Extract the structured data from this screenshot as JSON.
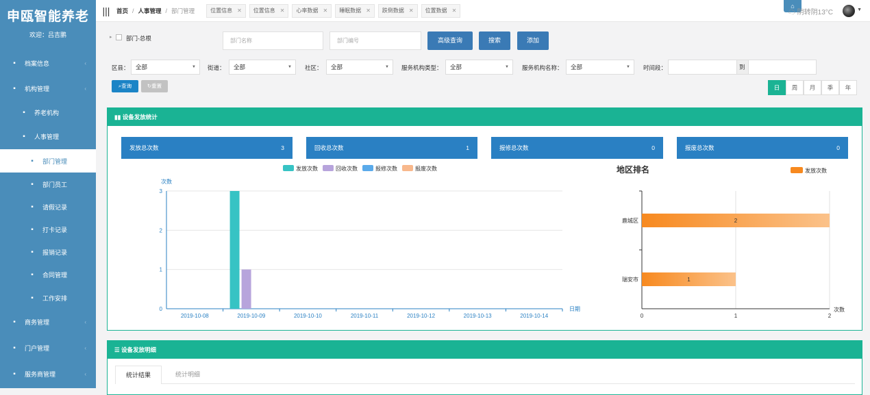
{
  "app": {
    "logo": "申瓯智能养老",
    "welcome": "欢迎：吕吉鹏"
  },
  "sidebar": {
    "items": [
      {
        "label": "档案信息",
        "icon": "archive-icon"
      },
      {
        "label": "机构管理",
        "icon": "users-icon"
      },
      {
        "label": "养老机构",
        "icon": "elder-icon"
      },
      {
        "label": "人事管理",
        "icon": "users-icon"
      },
      {
        "label": "部门管理",
        "icon": "sitemap-icon"
      },
      {
        "label": "部门员工",
        "icon": "id-card-icon"
      },
      {
        "label": "请假记录",
        "icon": "user-clock-icon"
      },
      {
        "label": "打卡记录",
        "icon": "map-pin-icon"
      },
      {
        "label": "报销记录",
        "icon": "receipt-icon"
      },
      {
        "label": "合同管理",
        "icon": "contract-icon"
      },
      {
        "label": "工作安排",
        "icon": "worker-icon"
      },
      {
        "label": "商务管理",
        "icon": "briefcase-icon"
      },
      {
        "label": "门户管理",
        "icon": "home-icon"
      },
      {
        "label": "服务商管理",
        "icon": "user-icon"
      }
    ]
  },
  "topbar": {
    "breadcrumb": [
      "首页",
      "人事管理",
      "部门管理"
    ],
    "tabs": [
      "位置信息",
      "位置信息",
      "心率数据",
      "睡眠数据",
      "跌倒数据",
      "位置数据"
    ],
    "weather": "阴转阴13°C",
    "home_glyph": "⌂"
  },
  "filters": {
    "tree_label": "部门-总根",
    "dept_name_placeholder": "部门名称",
    "dept_code_placeholder": "部门编号",
    "advanced": "高级查询",
    "search": "搜索",
    "add": "添加",
    "district_label": "区县：",
    "district_value": "全部",
    "street_label": "街道：",
    "street_value": "全部",
    "community_label": "社区：",
    "community_value": "全部",
    "org_type_label": "服务机构类型：",
    "org_type_value": "全部",
    "org_name_label": "服务机构名称：",
    "org_name_value": "全部",
    "time_label": "时间段：",
    "time_to": "到",
    "query": "查询",
    "reset": "重置",
    "periods": [
      "日",
      "周",
      "月",
      "季",
      "年"
    ],
    "active_period": "日"
  },
  "stats_panel": {
    "title": "设备发放统计",
    "cards": [
      {
        "label": "发放总次数",
        "value": "3"
      },
      {
        "label": "回收总次数",
        "value": "1"
      },
      {
        "label": "报修总次数",
        "value": "0"
      },
      {
        "label": "报废总次数",
        "value": "0"
      }
    ]
  },
  "chart_data": [
    {
      "type": "bar",
      "xlabel": "日期",
      "ylabel": "次数",
      "ylim": [
        0,
        3
      ],
      "yticks": [
        0,
        1,
        2,
        3
      ],
      "categories": [
        "2019-10-08",
        "2019-10-09",
        "2019-10-10",
        "2019-10-11",
        "2019-10-12",
        "2019-10-13",
        "2019-10-14"
      ],
      "series": [
        {
          "name": "发放次数",
          "color": "#37c3c4",
          "values": [
            0,
            3,
            0,
            0,
            0,
            0,
            0
          ]
        },
        {
          "name": "回收次数",
          "color": "#b7a4dc",
          "values": [
            0,
            1,
            0,
            0,
            0,
            0,
            0
          ]
        },
        {
          "name": "报修次数",
          "color": "#5aaaea",
          "values": [
            0,
            0,
            0,
            0,
            0,
            0,
            0
          ]
        },
        {
          "name": "报废次数",
          "color": "#f8b88c",
          "values": [
            0,
            0,
            0,
            0,
            0,
            0,
            0
          ]
        }
      ],
      "legend": "top-center",
      "grid": true
    },
    {
      "type": "bar",
      "orientation": "horizontal",
      "title": "地区排名",
      "xlabel": "次数",
      "xlim": [
        0,
        2
      ],
      "xticks": [
        0,
        1,
        2
      ],
      "categories": [
        "鹿城区",
        "瑞安市"
      ],
      "series": [
        {
          "name": "发放次数",
          "color": "#f7891f",
          "values": [
            2,
            1
          ],
          "labels": [
            "2",
            "1"
          ]
        }
      ],
      "legend": "top-right",
      "grid": true
    }
  ],
  "detail_panel": {
    "title": "设备发放明细",
    "tabs": [
      "统计结果",
      "统计明细"
    ]
  }
}
